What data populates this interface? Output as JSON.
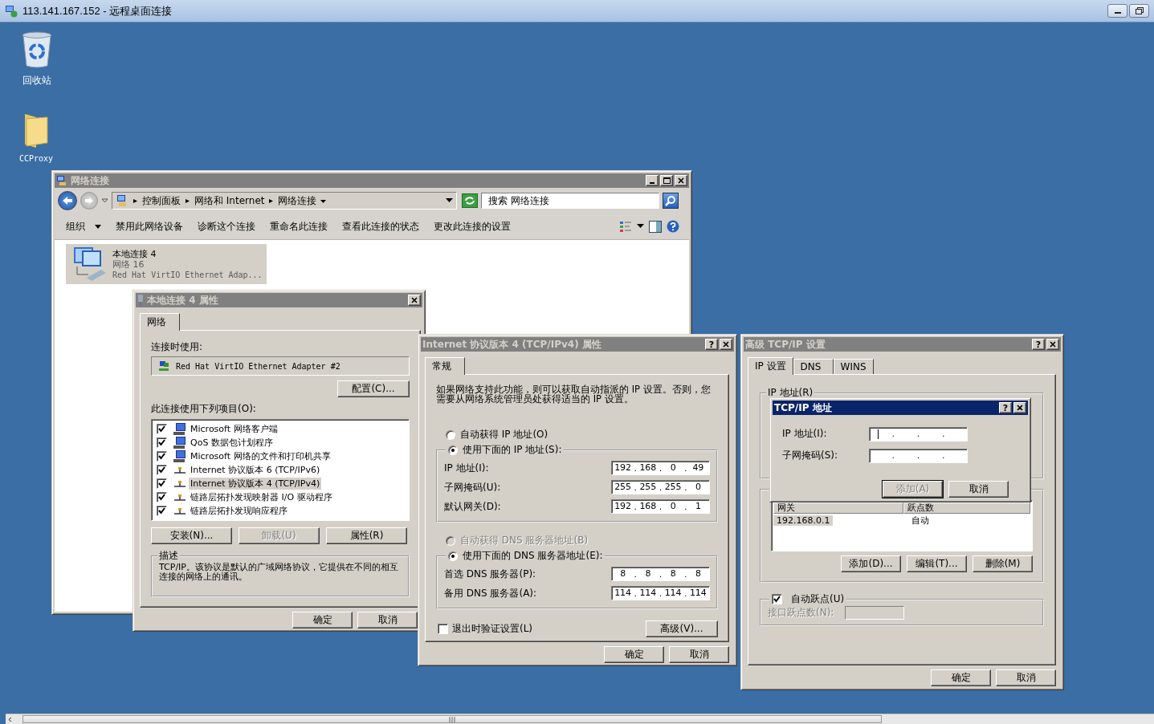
{
  "remote_window": {
    "title": "113.141.167.152 - 远程桌面连接"
  },
  "desktop_icons": [
    {
      "label": "回收站",
      "kind": "recycle-bin"
    },
    {
      "label": "CCProxy",
      "kind": "folder"
    }
  ],
  "ip_separator": ".",
  "network_window": {
    "title": "网络连接",
    "breadcrumb": [
      "控制面板",
      "网络和 Internet",
      "网络连接"
    ],
    "search": {
      "placeholder": "搜索 网络连接"
    },
    "toolbar": [
      {
        "label": "组织",
        "dropdown": true
      },
      {
        "label": "禁用此网络设备",
        "dropdown": false
      },
      {
        "label": "诊断这个连接",
        "dropdown": false
      },
      {
        "label": "重命名此连接",
        "dropdown": false
      },
      {
        "label": "查看此连接的状态",
        "dropdown": false
      },
      {
        "label": "更改此连接的设置",
        "dropdown": false
      }
    ],
    "connections": [
      {
        "name": "本地连接 4",
        "network": "网络  16",
        "adapter": "Red Hat VirtIO Ethernet Adap...",
        "selected": true
      }
    ]
  },
  "properties_dialog": {
    "title": "本地连接 4 属性",
    "tabs": [
      {
        "label": "网络",
        "selected": true
      }
    ],
    "connect_using_label": "连接时使用:",
    "adapter": "Red Hat VirtIO Ethernet Adapter #2",
    "configure_button": "配置(C)...",
    "items_label": "此连接使用下列项目(O):",
    "items": [
      {
        "label": "Microsoft 网络客户端",
        "kind": "service",
        "checked": true,
        "selected": false
      },
      {
        "label": "QoS 数据包计划程序",
        "kind": "service",
        "checked": true,
        "selected": false
      },
      {
        "label": "Microsoft 网络的文件和打印机共享",
        "kind": "service",
        "checked": true,
        "selected": false
      },
      {
        "label": "Internet 协议版本 6 (TCP/IPv6)",
        "kind": "protocol",
        "checked": true,
        "selected": false
      },
      {
        "label": "Internet 协议版本 4 (TCP/IPv4)",
        "kind": "protocol",
        "checked": true,
        "selected": true
      },
      {
        "label": "链路层拓扑发现映射器 I/O 驱动程序",
        "kind": "protocol",
        "checked": true,
        "selected": false
      },
      {
        "label": "链路层拓扑发现响应程序",
        "kind": "protocol",
        "checked": true,
        "selected": false
      }
    ],
    "buttons": [
      {
        "label": "安装(N)...",
        "disabled": false
      },
      {
        "label": "卸载(U)",
        "disabled": true
      },
      {
        "label": "属性(R)",
        "disabled": false
      }
    ],
    "description_title": "描述",
    "description": "TCP/IP。该协议是默认的广域网络协议，它提供在不同的相互连接的网络上的通讯。",
    "footer_buttons": [
      "确定",
      "取消"
    ]
  },
  "ipv4_dialog": {
    "title": "Internet 协议版本 4 (TCP/IPv4) 属性",
    "help_button": "?",
    "tabs": [
      {
        "label": "常规",
        "selected": true
      }
    ],
    "intro": "如果网络支持此功能，则可以获取自动指派的 IP 设置。否则，您需要从网络系统管理员处获得适当的 IP 设置。",
    "ip_mode": [
      {
        "label": "自动获得 IP 地址(O)",
        "selected": false,
        "disabled": false
      },
      {
        "label": "使用下面的 IP 地址(S):",
        "selected": true,
        "disabled": false
      }
    ],
    "ip_fields": [
      {
        "label": "IP 地址(I):",
        "octets": [
          "192",
          "168",
          "0",
          "49"
        ]
      },
      {
        "label": "子网掩码(U):",
        "octets": [
          "255",
          "255",
          "255",
          "0"
        ]
      },
      {
        "label": "默认网关(D):",
        "octets": [
          "192",
          "168",
          "0",
          "1"
        ]
      }
    ],
    "dns_mode": [
      {
        "label": "自动获得 DNS 服务器地址(B)",
        "selected": false,
        "disabled": true
      },
      {
        "label": "使用下面的 DNS 服务器地址(E):",
        "selected": true,
        "disabled": false
      }
    ],
    "dns_fields": [
      {
        "label": "首选 DNS 服务器(P):",
        "octets": [
          "8",
          "8",
          "8",
          "8"
        ]
      },
      {
        "label": "备用 DNS 服务器(A):",
        "octets": [
          "114",
          "114",
          "114",
          "114"
        ]
      }
    ],
    "validate": {
      "label": "退出时验证设置(L)",
      "checked": false
    },
    "advanced_button": "高级(V)...",
    "footer_buttons": [
      "确定",
      "取消"
    ]
  },
  "advanced_dialog": {
    "title": "高级 TCP/IP 设置",
    "help_button": "?",
    "tabs": [
      {
        "label": "IP 设置",
        "selected": true
      },
      {
        "label": "DNS",
        "selected": false
      },
      {
        "label": "WINS",
        "selected": false
      }
    ],
    "ip_group_label": "IP 地址(R)",
    "gateway_table": {
      "columns": [
        "网关",
        "跃点数"
      ],
      "rows": [
        {
          "cells": [
            "192.168.0.1",
            "自动"
          ],
          "selected": true
        }
      ]
    },
    "gateway_buttons": [
      "添加(D)...",
      "编辑(T)...",
      "删除(M)"
    ],
    "auto_metric": {
      "label": "自动跃点(U)",
      "checked": true
    },
    "interface_metric": {
      "label": "接口跃点数(N):",
      "disabled": true
    },
    "footer_buttons": [
      "确定",
      "取消"
    ]
  },
  "address_dialog": {
    "title": "TCP/IP 地址",
    "help_button": "?",
    "fields": [
      {
        "label": "IP 地址(I):",
        "focused": true
      },
      {
        "label": "子网掩码(S):"
      }
    ],
    "buttons": [
      {
        "label": "添加(A)",
        "disabled": true,
        "default": true
      },
      {
        "label": "取消",
        "disabled": false,
        "default": false
      }
    ]
  }
}
